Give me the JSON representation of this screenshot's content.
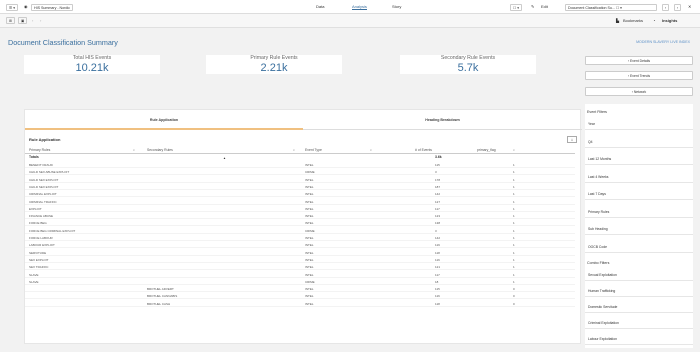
{
  "topbar": {
    "app_label": "HIS Summary - Nordic",
    "nav_tabs": [
      "Data",
      "Analysis",
      "Story"
    ],
    "edit_label": "Edit",
    "sheet_select": "Document Classification Su..."
  },
  "subbar": {
    "bookmarks_label": "Bookmarks",
    "insights_label": "Insights"
  },
  "page": {
    "title": "Document Classification Summary",
    "sheet_link": "MODERN SLAVERY LIVE INDEX"
  },
  "kpis": [
    {
      "label": "Total HIS Events",
      "value": "10.21k"
    },
    {
      "label": "Primary Rule Events",
      "value": "2.21k"
    },
    {
      "label": "Secondary Rule Events",
      "value": "5.7k"
    }
  ],
  "right_buttons": [
    "Event Details",
    "Event Trends",
    "Network"
  ],
  "tabs": [
    "Rule Application",
    "Heading Breakdown"
  ],
  "section": {
    "title": "Rule Application",
    "export_label": "⇩"
  },
  "table": {
    "headers": [
      "Primary Rules",
      "Secondary Rules",
      "Event Type",
      "# of Events",
      "primary_flag"
    ],
    "totals": {
      "label": "Totals",
      "events": "3.6k"
    },
    "rows": [
      {
        "primary": "BENEFIT FRAUD",
        "secondary": "",
        "type": "INTEL",
        "events": "115",
        "flag": "1"
      },
      {
        "primary": "CHILD SEX ABUSE EXPLOIT",
        "secondary": "",
        "type": "CRIME",
        "events": "3",
        "flag": "1"
      },
      {
        "primary": "CHILD SEX EXPLOIT",
        "secondary": "",
        "type": "INTEL",
        "events": "178",
        "flag": "1"
      },
      {
        "primary": "CHILD SEX EXPLOIT",
        "secondary": "",
        "type": "INTEL",
        "events": "187",
        "flag": "1"
      },
      {
        "primary": "CRIMINAL EXPLOIT",
        "secondary": "",
        "type": "INTEL",
        "events": "142",
        "flag": "1"
      },
      {
        "primary": "CRIMINAL TRAFFIC",
        "secondary": "",
        "type": "INTEL",
        "events": "127",
        "flag": "1"
      },
      {
        "primary": "EXPLOIT",
        "secondary": "",
        "type": "INTEL",
        "events": "117",
        "flag": "1"
      },
      {
        "primary": "FINANCE ABUSE",
        "secondary": "",
        "type": "INTEL",
        "events": "123",
        "flag": "1"
      },
      {
        "primary": "FORCE BEG",
        "secondary": "",
        "type": "INTEL",
        "events": "138",
        "flag": "1"
      },
      {
        "primary": "FORCE BEG CRIMINAL EXPLOIT",
        "secondary": "",
        "type": "CRIME",
        "events": "3",
        "flag": "1"
      },
      {
        "primary": "FORCE LABOUR",
        "secondary": "",
        "type": "INTEL",
        "events": "142",
        "flag": "1"
      },
      {
        "primary": "LABOUR EXPLOIT",
        "secondary": "",
        "type": "INTEL",
        "events": "119",
        "flag": "1"
      },
      {
        "primary": "SERVITUDE",
        "secondary": "",
        "type": "INTEL",
        "events": "118",
        "flag": "1"
      },
      {
        "primary": "SEX EXPLOIT",
        "secondary": "",
        "type": "INTEL",
        "events": "116",
        "flag": "1"
      },
      {
        "primary": "SEX TRAFFIC",
        "secondary": "",
        "type": "INTEL",
        "events": "121",
        "flag": "1"
      },
      {
        "primary": "SLAVE",
        "secondary": "",
        "type": "INTEL",
        "events": "117",
        "flag": "1"
      },
      {
        "primary": "SLAVE",
        "secondary": "",
        "type": "CRIME",
        "events": "18",
        "flag": "1"
      },
      {
        "primary": "",
        "secondary": "BROTHEL ADVERT",
        "type": "INTEL",
        "events": "115",
        "flag": "0"
      },
      {
        "primary": "",
        "secondary": "BROTHEL CANNABIS",
        "type": "INTEL",
        "events": "116",
        "flag": "0"
      },
      {
        "primary": "",
        "secondary": "BROTHEL CASH",
        "type": "INTEL",
        "events": "118",
        "flag": "0"
      }
    ]
  },
  "filters": {
    "event_head": "Event Filters",
    "event_items": [
      "Year",
      "Q4",
      "Last 12 Months",
      "Last 4 Weeks",
      "Last 7 Days",
      "Primary Rules",
      "Sub Heading",
      "OOCB Code"
    ],
    "combo_head": "Combo Filters",
    "combo_items": [
      "Sexual Exploitation",
      "Human Trafficking",
      "Domestic Servitude",
      "Criminal Exploitation",
      "Labour Exploitation"
    ]
  }
}
